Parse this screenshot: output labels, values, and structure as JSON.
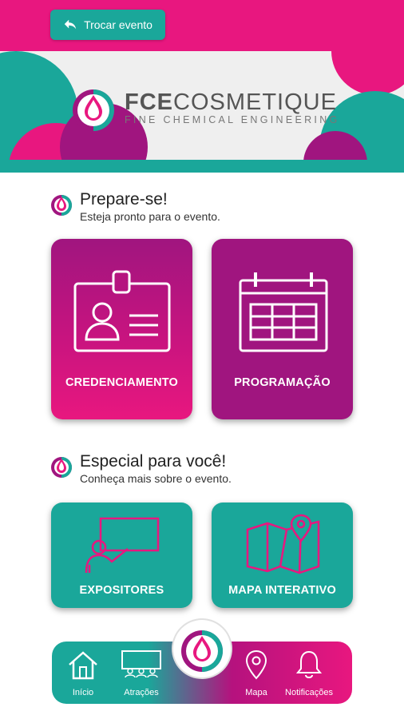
{
  "header": {
    "back_label": "Trocar evento"
  },
  "logo": {
    "title_bold": "FCE",
    "title_rest": "COSMETIQUE",
    "subtitle": "FINE CHEMICAL ENGINEERING"
  },
  "sections": [
    {
      "title": "Prepare-se!",
      "subtitle": "Esteja pronto para o evento."
    },
    {
      "title": "Especial para você!",
      "subtitle": "Conheça mais sobre o evento."
    }
  ],
  "cards": [
    {
      "label": "CREDENCIAMENTO",
      "icon": "badge-icon"
    },
    {
      "label": "PROGRAMAÇÃO",
      "icon": "calendar-icon"
    },
    {
      "label": "EXPOSITORES",
      "icon": "presenter-icon"
    },
    {
      "label": "MAPA INTERATIVO",
      "icon": "map-icon"
    }
  ],
  "nav": [
    {
      "label": "Início",
      "icon": "home-icon"
    },
    {
      "label": "Atrações",
      "icon": "stage-icon"
    },
    {
      "label": "Mapa",
      "icon": "location-pin-icon"
    },
    {
      "label": "Notificações",
      "icon": "bell-icon"
    }
  ],
  "colors": {
    "pink": "#e8177f",
    "purple": "#a0157f",
    "teal": "#1aa79a"
  }
}
